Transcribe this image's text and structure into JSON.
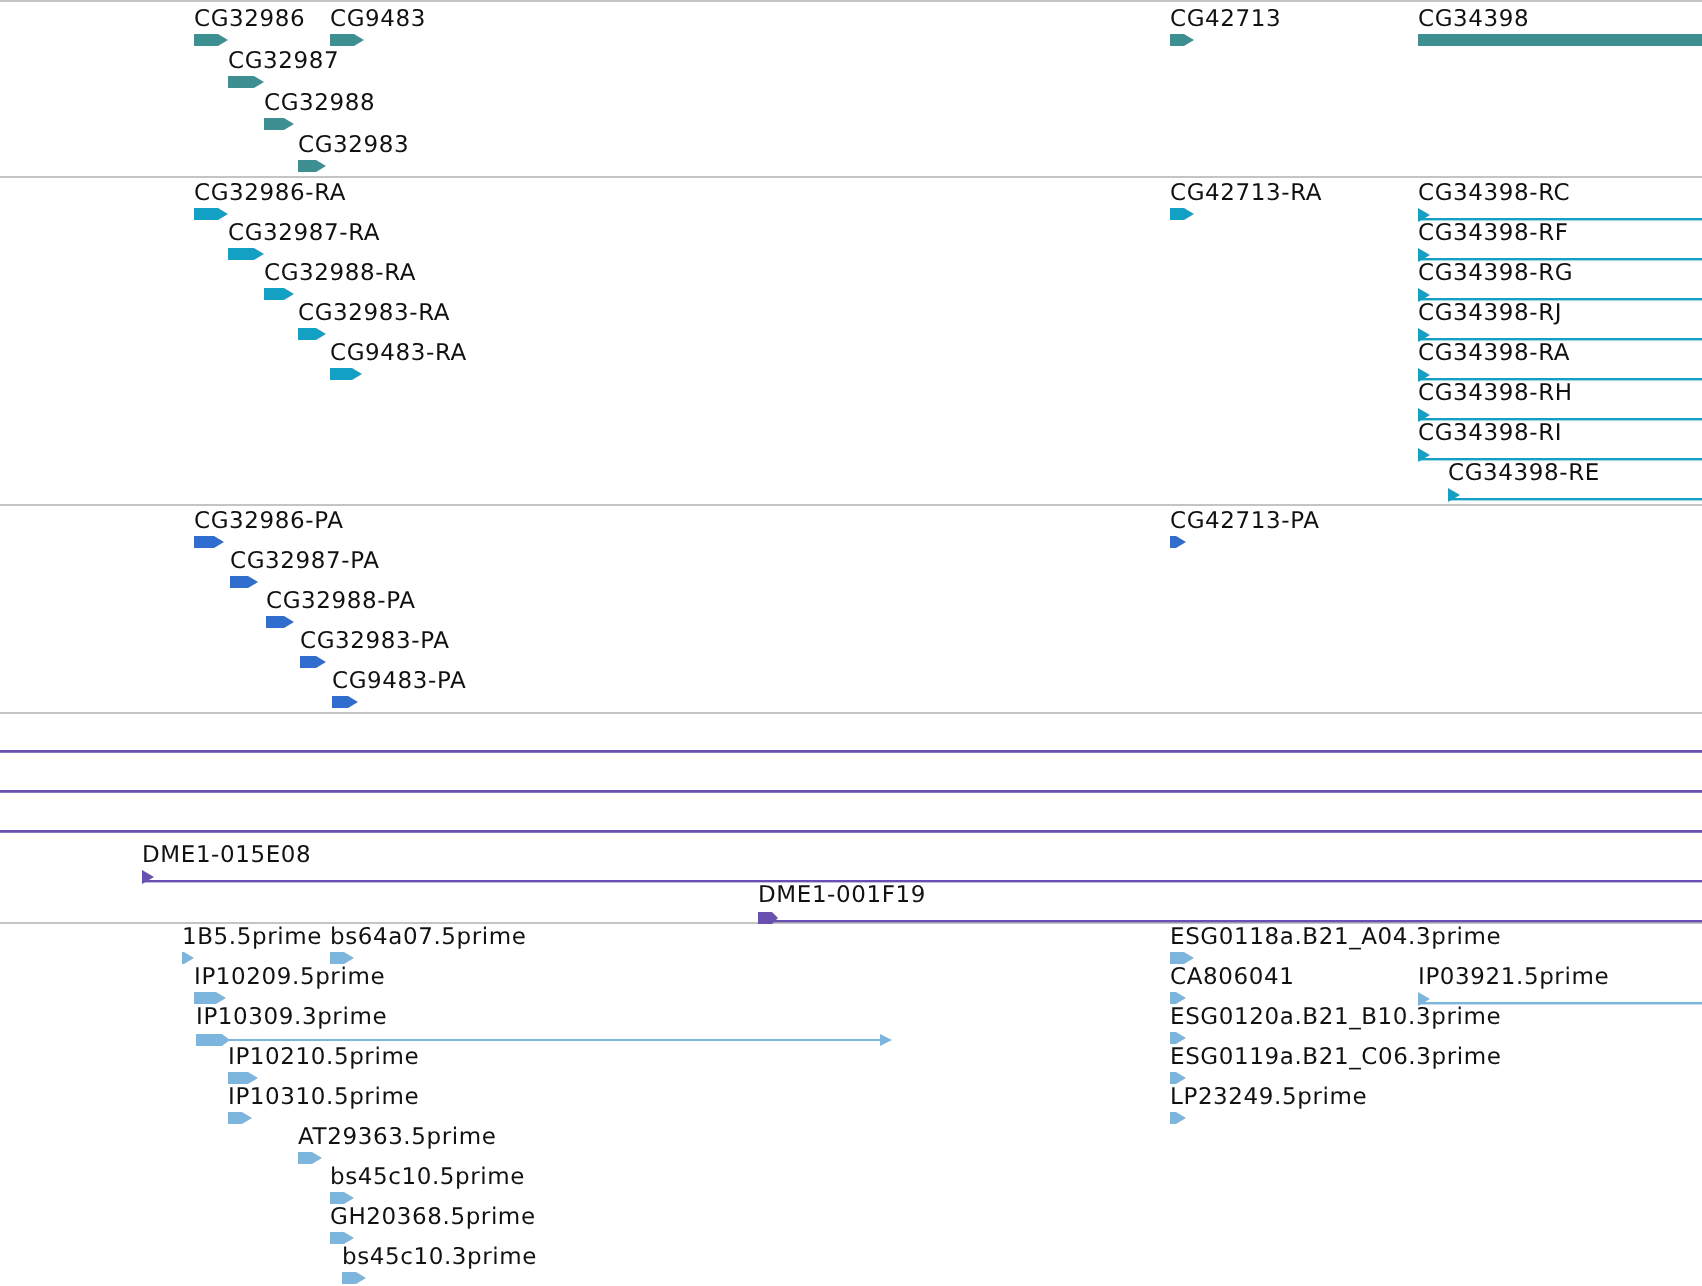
{
  "tracks": [
    {
      "color": "#3d8f92",
      "features": [
        {
          "label": "CG32986",
          "kind": "arrow"
        },
        {
          "label": "CG9483",
          "kind": "arrow"
        },
        {
          "label": "CG32987",
          "kind": "arrow"
        },
        {
          "label": "CG32988",
          "kind": "arrow"
        },
        {
          "label": "CG32983",
          "kind": "arrow"
        },
        {
          "label": "CG42713",
          "kind": "arrow"
        },
        {
          "label": "CG34398",
          "kind": "bar"
        }
      ]
    },
    {
      "color": "#12a0c4",
      "features": [
        {
          "label": "CG32986-RA",
          "kind": "arrow"
        },
        {
          "label": "CG32987-RA",
          "kind": "arrow"
        },
        {
          "label": "CG32988-RA",
          "kind": "arrow"
        },
        {
          "label": "CG32983-RA",
          "kind": "arrow"
        },
        {
          "label": "CG9483-RA",
          "kind": "arrow"
        },
        {
          "label": "CG42713-RA",
          "kind": "arrow"
        },
        {
          "label": "CG34398-RC",
          "kind": "line"
        },
        {
          "label": "CG34398-RF",
          "kind": "line"
        },
        {
          "label": "CG34398-RG",
          "kind": "line"
        },
        {
          "label": "CG34398-RJ",
          "kind": "line"
        },
        {
          "label": "CG34398-RA",
          "kind": "line"
        },
        {
          "label": "CG34398-RH",
          "kind": "line"
        },
        {
          "label": "CG34398-RI",
          "kind": "line"
        },
        {
          "label": "CG34398-RE",
          "kind": "line"
        }
      ]
    },
    {
      "color": "#2f6ecf",
      "features": [
        {
          "label": "CG32986-PA",
          "kind": "arrow"
        },
        {
          "label": "CG32987-PA",
          "kind": "arrow"
        },
        {
          "label": "CG32988-PA",
          "kind": "arrow"
        },
        {
          "label": "CG32983-PA",
          "kind": "arrow"
        },
        {
          "label": "CG9483-PA",
          "kind": "arrow"
        },
        {
          "label": "CG42713-PA",
          "kind": "arrow"
        }
      ]
    },
    {
      "color": "#6a50b0",
      "features": [
        {
          "kind": "rule"
        },
        {
          "kind": "rule"
        },
        {
          "kind": "rule"
        },
        {
          "label": "DME1-015E08",
          "kind": "line"
        },
        {
          "label": "DME1-001F19",
          "kind": "block-line"
        }
      ]
    },
    {
      "color": "#7cb5de",
      "features": [
        {
          "label": "1B5.5prime",
          "kind": "arrow"
        },
        {
          "label": "bs64a07.5prime",
          "kind": "arrow"
        },
        {
          "label": "IP10209.5prime",
          "kind": "arrow"
        },
        {
          "label": "IP10309.3prime",
          "kind": "arrow-line"
        },
        {
          "label": "IP10210.5prime",
          "kind": "arrow"
        },
        {
          "label": "IP10310.5prime",
          "kind": "arrow"
        },
        {
          "label": "AT29363.5prime",
          "kind": "arrow"
        },
        {
          "label": "bs45c10.5prime",
          "kind": "arrow"
        },
        {
          "label": "GH20368.5prime",
          "kind": "arrow"
        },
        {
          "label": "bs45c10.3prime",
          "kind": "arrow"
        },
        {
          "label": "ESG0118a.B21_A04.3prime",
          "kind": "arrow"
        },
        {
          "label": "CA806041",
          "kind": "arrow"
        },
        {
          "label": "IP03921.5prime",
          "kind": "line"
        },
        {
          "label": "ESG0120a.B21_B10.3prime",
          "kind": "arrow"
        },
        {
          "label": "ESG0119a.B21_C06.3prime",
          "kind": "arrow"
        },
        {
          "label": "LP23249.5prime",
          "kind": "arrow"
        }
      ]
    }
  ]
}
